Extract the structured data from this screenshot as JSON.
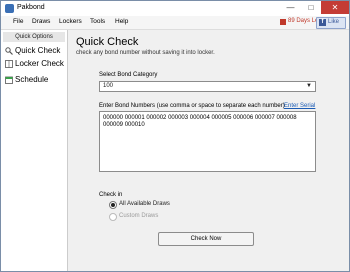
{
  "window": {
    "title": "Pakbond"
  },
  "menu": [
    "File",
    "Draws",
    "Lockers",
    "Tools",
    "Help"
  ],
  "trial": {
    "text": "89 Days Left (Trial)"
  },
  "like": {
    "label": "Like"
  },
  "sidebar": {
    "header": "Quick Options",
    "items": [
      {
        "label": "Quick Check",
        "icon": "magnifier-icon"
      },
      {
        "label": "Locker Check",
        "icon": "locker-icon"
      },
      {
        "label": "Schedule",
        "icon": "schedule-icon"
      }
    ]
  },
  "main": {
    "title": "Quick Check",
    "subtitle": "check any bond number without saving it into locker.",
    "category_label": "Select Bond Category",
    "category_value": "100",
    "numbers_label": "Enter Bond Numbers (use comma or space to separate each number)",
    "enter_serial": "Enter Serial",
    "numbers_value": "000000 000001 000002 000003 000004 000005 000006 000007 000008 000009 000010",
    "check_in_label": "Check in",
    "radio_all": "All Available Draws",
    "radio_custom": "Custom Draws",
    "check_button": "Check Now"
  },
  "colors": {
    "trial": "#c0392b",
    "close": "#c43c35",
    "link": "#1a5bb5",
    "facebook": "#3b5998"
  }
}
